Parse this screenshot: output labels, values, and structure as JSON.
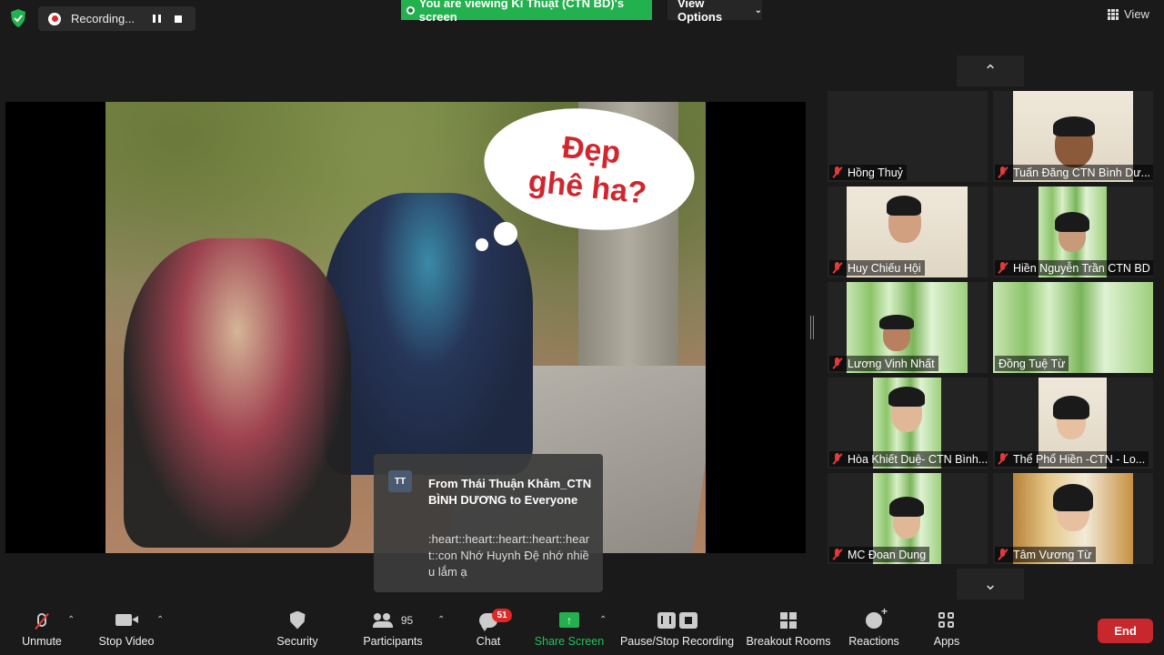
{
  "topbar": {
    "recording_label": "Recording...",
    "viewing_banner": "You are viewing Kĩ Thuật (CTN BD)'s screen",
    "view_options": "View Options",
    "view_label": "View"
  },
  "shared_screen": {
    "bubble_line1": "Đẹp",
    "bubble_line2": "ghê ha?"
  },
  "chat_notification": {
    "avatar_initials": "TT",
    "from": "From Thái Thuận Khâm_CTN BÌNH DƯƠNG to Everyone",
    "message": ":heart::heart::heart::heart::heart::con Nhớ Huynh Đệ nhớ nhiều lắm ạ"
  },
  "gallery": {
    "tiles": [
      {
        "name": "Hồng Thuỷ"
      },
      {
        "name": "Tuấn Đăng CTN Bình Dư..."
      },
      {
        "name": "Huy Chiếu Hội"
      },
      {
        "name": "Hiền Nguyễn Trần CTN BD"
      },
      {
        "name": "Lương Vinh Nhất"
      },
      {
        "name": "Đồng Tuệ Từ"
      },
      {
        "name": "Hòa Khiết Duệ- CTN Bình..."
      },
      {
        "name": "Thể Phổ Hiền -CTN - Lo..."
      },
      {
        "name": "MC Đoan Dung"
      },
      {
        "name": "Tâm Vương Từ"
      }
    ]
  },
  "toolbar": {
    "unmute": "Unmute",
    "stop_video": "Stop Video",
    "security": "Security",
    "participants": "Participants",
    "participants_count": "95",
    "chat": "Chat",
    "chat_badge": "51",
    "share_screen": "Share Screen",
    "pause_stop_recording": "Pause/Stop Recording",
    "breakout_rooms": "Breakout Rooms",
    "reactions": "Reactions",
    "apps": "Apps",
    "end": "End"
  },
  "colors": {
    "accent_green": "#23b04e",
    "end_red": "#c8272d",
    "muted_red": "#e03a3a"
  }
}
